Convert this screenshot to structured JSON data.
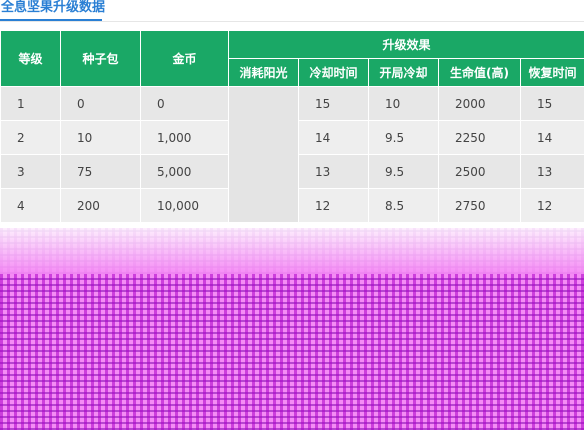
{
  "section": {
    "title": "全息坚果升级数据"
  },
  "table": {
    "headers": {
      "level": "等级",
      "seed_packs": "种子包",
      "coins": "金币",
      "upgrade_effect": "升级效果",
      "sub": [
        "消耗阳光",
        "冷却时间",
        "开局冷却",
        "生命值(高)",
        "恢复时间"
      ]
    },
    "rows": [
      {
        "level": "1",
        "seed_packs": "0",
        "coins": "0",
        "cooldown": "15",
        "start_cooldown": "10",
        "health": "2000",
        "recovery": "15"
      },
      {
        "level": "2",
        "seed_packs": "10",
        "coins": "1,000",
        "cooldown": "14",
        "start_cooldown": "9.5",
        "health": "2250",
        "recovery": "14"
      },
      {
        "level": "3",
        "seed_packs": "75",
        "coins": "5,000",
        "cooldown": "13",
        "start_cooldown": "9.5",
        "health": "2500",
        "recovery": "13"
      },
      {
        "level": "4",
        "seed_packs": "200",
        "coins": "10,000",
        "cooldown": "12",
        "start_cooldown": "8.5",
        "health": "2750",
        "recovery": "12"
      }
    ]
  },
  "colors": {
    "header_green": "#1aa866",
    "title_blue": "#2a7fd4",
    "row_gray": "#e7e7e7",
    "corruption_magenta": "#f58cf5"
  }
}
